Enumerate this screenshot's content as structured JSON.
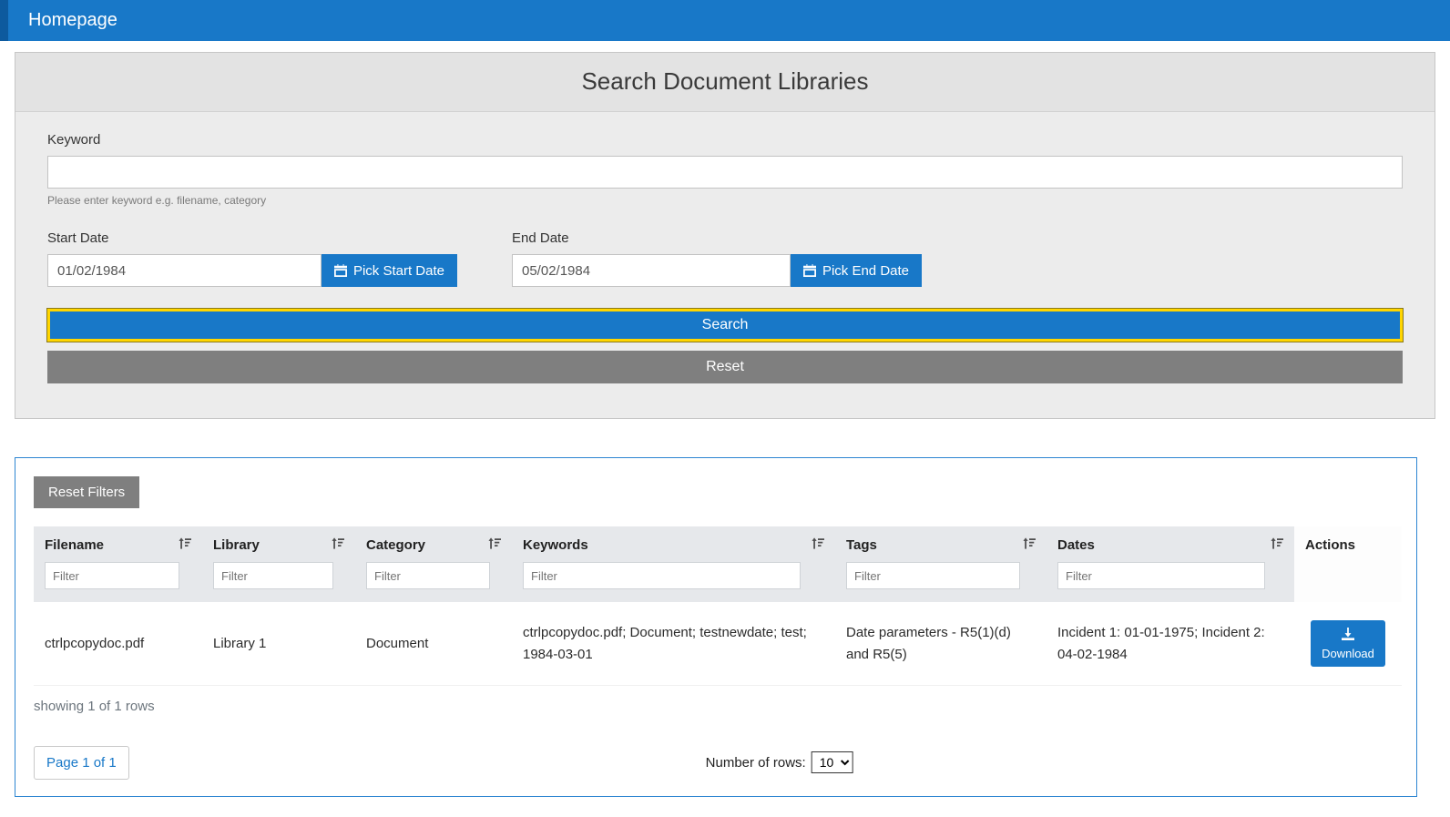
{
  "header": {
    "title": "Homepage"
  },
  "search_panel": {
    "title": "Search Document Libraries",
    "keyword": {
      "label": "Keyword",
      "value": "",
      "help": "Please enter keyword e.g. filename, category"
    },
    "start_date": {
      "label": "Start Date",
      "value": "01/02/1984",
      "button_label": "Pick Start Date"
    },
    "end_date": {
      "label": "End Date",
      "value": "05/02/1984",
      "button_label": "Pick End Date"
    },
    "search_button": "Search",
    "reset_button": "Reset"
  },
  "results_panel": {
    "reset_filters_button": "Reset Filters",
    "table": {
      "columns": [
        {
          "label": "Filename",
          "filter_placeholder": "Filter"
        },
        {
          "label": "Library",
          "filter_placeholder": "Filter"
        },
        {
          "label": "Category",
          "filter_placeholder": "Filter"
        },
        {
          "label": "Keywords",
          "filter_placeholder": "Filter"
        },
        {
          "label": "Tags",
          "filter_placeholder": "Filter"
        },
        {
          "label": "Dates",
          "filter_placeholder": "Filter"
        }
      ],
      "actions_column_label": "Actions",
      "rows": [
        {
          "filename": "ctrlpcopydoc.pdf",
          "library": "Library 1",
          "category": "Document",
          "keywords": "ctrlpcopydoc.pdf; Document; testnewdate; test; 1984-03-01",
          "tags": "Date parameters - R5(1)(d) and R5(5)",
          "dates": "Incident 1: 01-01-1975; Incident 2: 04-02-1984",
          "action_label": "Download"
        }
      ]
    },
    "summary": "showing 1 of 1 rows",
    "pagination": {
      "page_label": "Page 1 of 1"
    },
    "rows_per_page": {
      "label": "Number of rows:",
      "value": "10"
    }
  },
  "colors": {
    "primary_blue": "#1878c8",
    "highlight_yellow": "#ffd500",
    "gray_button": "#7f7f7f",
    "panel_border_blue": "#2e86d2"
  }
}
